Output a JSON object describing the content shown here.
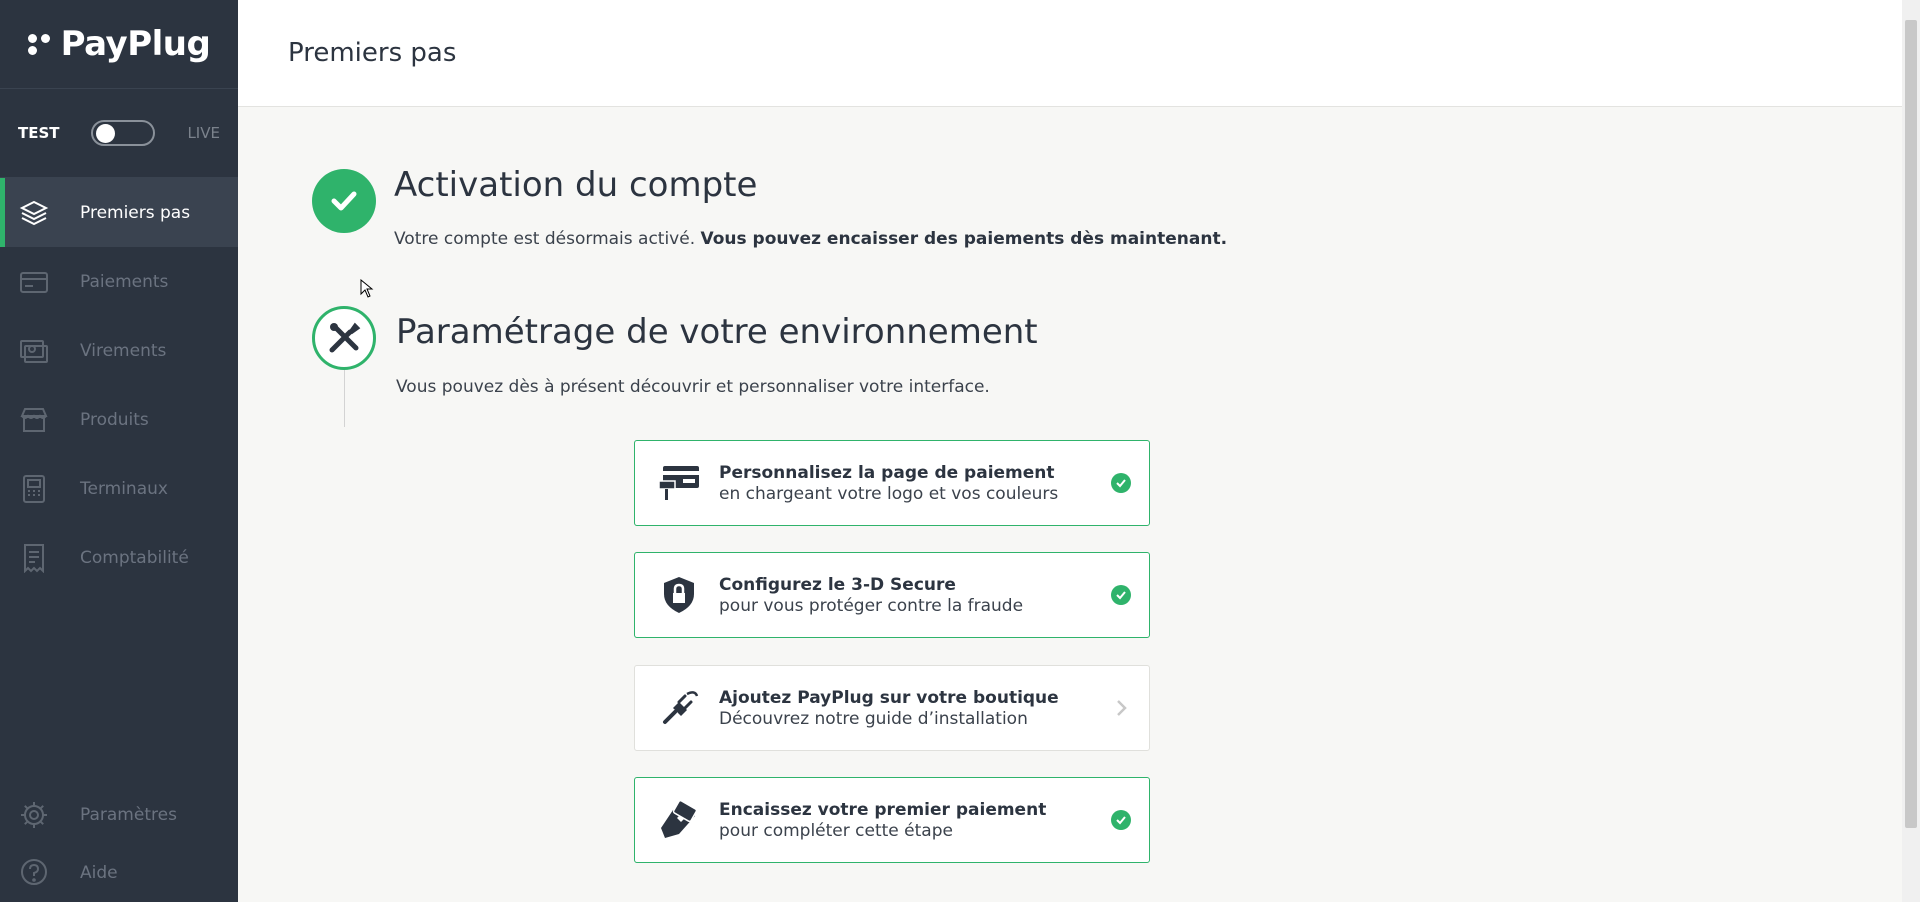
{
  "brand": {
    "name": "PayPlug"
  },
  "mode": {
    "test_label": "TEST",
    "live_label": "LIVE"
  },
  "nav": {
    "items": [
      {
        "label": "Premiers pas",
        "icon": "layers-icon",
        "active": true
      },
      {
        "label": "Paiements",
        "icon": "card-icon"
      },
      {
        "label": "Virements",
        "icon": "transfer-icon"
      },
      {
        "label": "Produits",
        "icon": "store-icon"
      },
      {
        "label": "Terminaux",
        "icon": "terminal-icon"
      },
      {
        "label": "Comptabilité",
        "icon": "receipt-icon"
      }
    ],
    "bottom": [
      {
        "label": "Paramètres",
        "icon": "gear-icon"
      },
      {
        "label": "Aide",
        "icon": "help-icon"
      }
    ]
  },
  "header": {
    "title": "Premiers pas"
  },
  "steps": {
    "activation": {
      "title": "Activation du compte",
      "desc_prefix": "Votre compte est désormais activé. ",
      "desc_bold": "Vous pouvez encaisser des paiements dès maintenant."
    },
    "setup": {
      "title": "Paramétrage de votre environnement",
      "desc": "Vous pouvez dès à présent découvrir et personnaliser votre interface."
    }
  },
  "cards": [
    {
      "title": "Personnalisez la page de paiement",
      "subtitle": "en chargeant votre logo et vos couleurs",
      "icon": "paint-card-icon",
      "status": "done"
    },
    {
      "title": "Configurez le 3-D Secure",
      "subtitle": "pour vous protéger contre la fraude",
      "icon": "shield-lock-icon",
      "status": "done"
    },
    {
      "title": "Ajoutez PayPlug sur votre boutique",
      "subtitle": "Découvrez notre guide d’installation",
      "icon": "plug-icon",
      "status": "pending"
    },
    {
      "title": "Encaissez votre premier paiement",
      "subtitle": "pour compléter cette étape",
      "icon": "hand-card-icon",
      "status": "done"
    }
  ],
  "colors": {
    "sidebar": "#2c3440",
    "accent": "#2fb36b",
    "text": "#2c3440"
  }
}
